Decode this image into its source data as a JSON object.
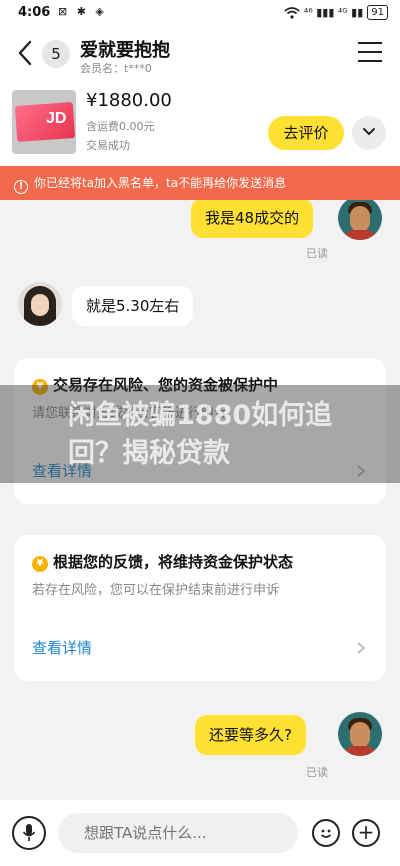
{
  "status_bar": {
    "time": "4:06",
    "left_icons": "⊠ ✱ ◈",
    "signal_text": "⁴⁶ ▮▮▮ ⁴ᴳ ▮▮",
    "battery": "91"
  },
  "header": {
    "unread_count": "5",
    "chat_name": "爱就要抱抱",
    "member_label": "会员名：t***0"
  },
  "product": {
    "thumb_mark": "JD",
    "price": "¥1880.00",
    "shipping": "含运费0.00元",
    "status": "交易成功",
    "review_label": "去评价"
  },
  "banner": {
    "icon": "!",
    "text": "你已经将ta加入黑名单，ta不能再给你发送消息"
  },
  "messages": [
    {
      "from": "me",
      "text": "我是48成交的",
      "read": "已读"
    },
    {
      "from": "other",
      "text": "就是5.30左右"
    }
  ],
  "system_cards": [
    {
      "yen": "¥",
      "title": "交易存在风险、您的资金被保护中",
      "body": "请您联系对方或平台客服进行申诉",
      "link": "查看详情"
    },
    {
      "yen": "¥",
      "title": "根据您的反馈，将维持资金保护状态",
      "body": "若存在风险，您可以在保护结束前进行申诉",
      "link": "查看详情"
    }
  ],
  "last_message": {
    "from": "me",
    "text": "还要等多久?",
    "read": "已读"
  },
  "input": {
    "placeholder": "想跟TA说点什么...",
    "plus": "+"
  },
  "overlay": {
    "text": "闲鱼被骗1880如何追回？揭秘贷款"
  }
}
